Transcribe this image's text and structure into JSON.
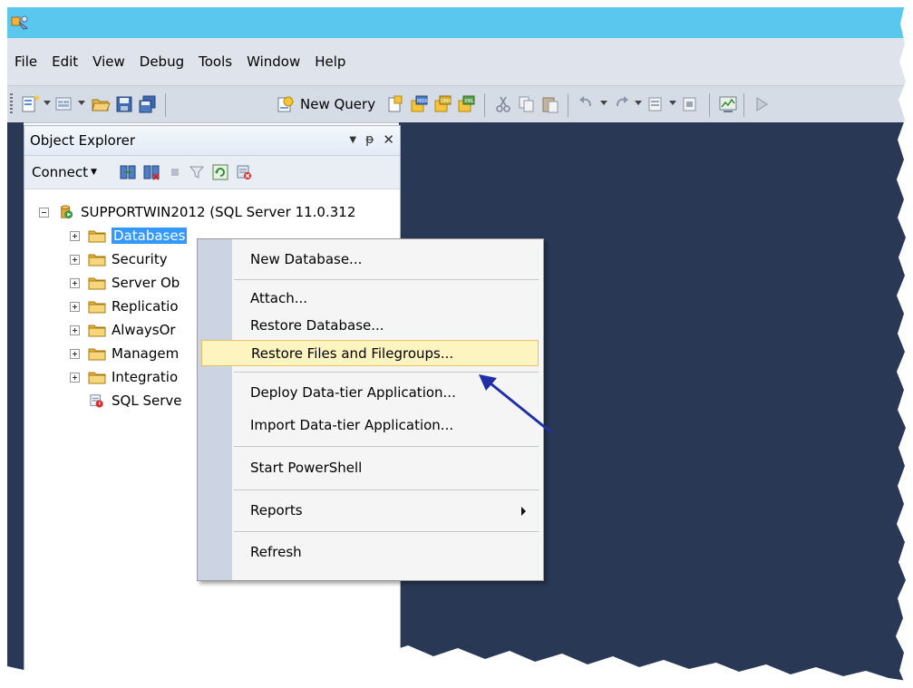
{
  "menu": [
    "File",
    "Edit",
    "View",
    "Debug",
    "Tools",
    "Window",
    "Help"
  ],
  "toolbar": {
    "new_query": "New Query"
  },
  "object_explorer": {
    "title": "Object Explorer",
    "pin_glyph": "▾ ᵽ ✕",
    "connect_label": "Connect",
    "server": "SUPPORTWIN2012 (SQL Server 11.0.312",
    "nodes": [
      "Databases",
      "Security",
      "Server Ob",
      "Replicatio",
      "AlwaysOr",
      "Managem",
      "Integratio",
      "SQL Serve"
    ]
  },
  "context_menu": {
    "items": [
      "New Database...",
      "Attach...",
      "Restore Database...",
      "Restore Files and Filegroups...",
      "Deploy Data-tier Application...",
      "Import Data-tier Application...",
      "Start PowerShell",
      "Reports",
      "Refresh"
    ]
  },
  "colors": {
    "titlebar": "#5ac8ee",
    "workspace": "#293955",
    "selection": "#3399ff",
    "menu_highlight": "#fdf4bf",
    "annotation_arrow": "#1f2fa8"
  }
}
